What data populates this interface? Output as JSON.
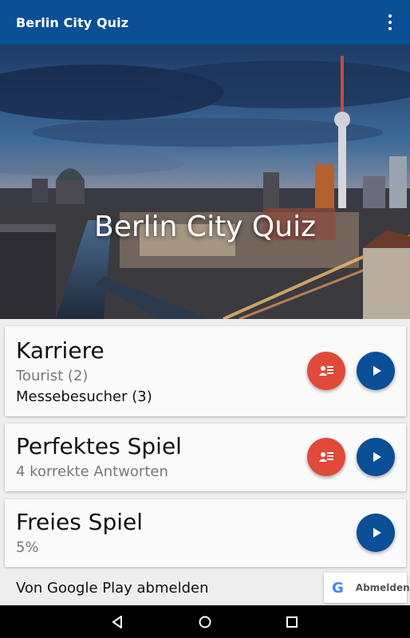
{
  "appbar": {
    "title": "Berlin City Quiz",
    "overflow_icon": "more-vert-icon"
  },
  "hero": {
    "title": "Berlin City Quiz"
  },
  "cards": {
    "career": {
      "title": "Karriere",
      "rank": "Tourist (2)",
      "next_rank": "Messebesucher (3)"
    },
    "perfect": {
      "title": "Perfektes Spiel",
      "detail": "4 korrekte Antworten"
    },
    "free": {
      "title": "Freies Spiel",
      "detail": "5%"
    }
  },
  "footer": {
    "signout_text": "Von Google Play abmelden",
    "signout_button": "Abmelden",
    "google_logo": "G"
  },
  "colors": {
    "primary": "#0b4f96",
    "accent_red": "#e04a3a",
    "background": "#eeeeee"
  },
  "icons": {
    "leaderboard": "leaderboard-icon",
    "play": "play-icon",
    "back": "back-icon",
    "home": "home-icon",
    "recents": "recents-icon"
  }
}
